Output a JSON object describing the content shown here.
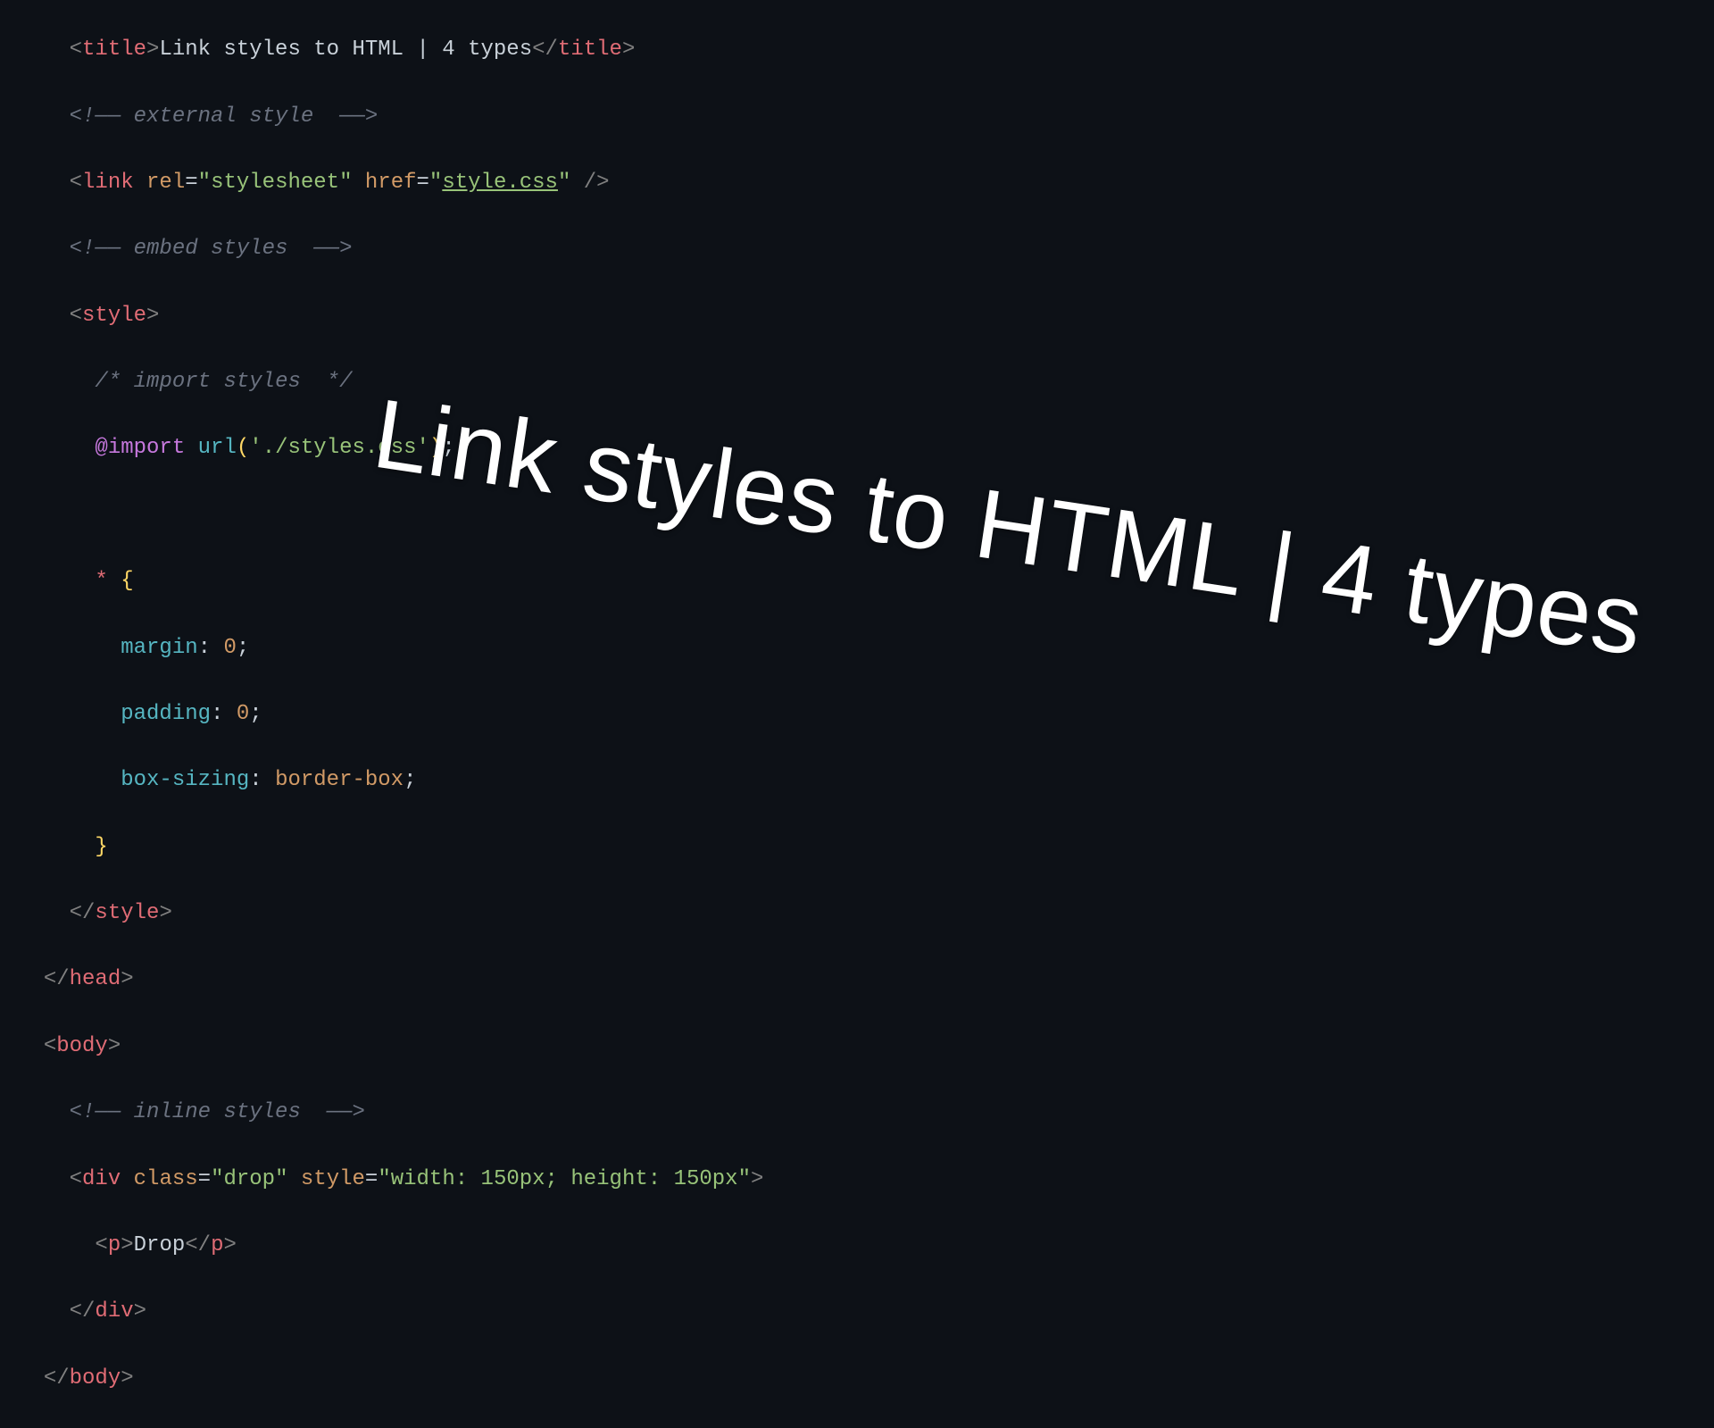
{
  "overlay_text": "Link styles to HTML | 4 types",
  "code": {
    "title_text": "Link styles to HTML | 4 types",
    "comment_external": " external style  ",
    "link_rel": "stylesheet",
    "link_href": "style.css",
    "comment_embed": " embed styles  ",
    "comment_import": " import styles  ",
    "import_url": "./styles.css",
    "reset_margin": "0",
    "reset_padding": "0",
    "reset_boxsizing": "border-box",
    "comment_inline": " inline styles  ",
    "div_class": "drop",
    "div_style": "width: 150px; height: 150px",
    "p_text": "Drop",
    "tags": {
      "title": "title",
      "link": "link",
      "style": "style",
      "head": "head",
      "body": "body",
      "div": "div",
      "p": "p"
    },
    "attrs": {
      "rel": "rel",
      "href": "href",
      "class": "class",
      "style": "style"
    },
    "css_props": {
      "margin": "margin",
      "padding": "padding",
      "box_sizing": "box-sizing"
    },
    "at_import": "@import",
    "url_fn": "url"
  }
}
